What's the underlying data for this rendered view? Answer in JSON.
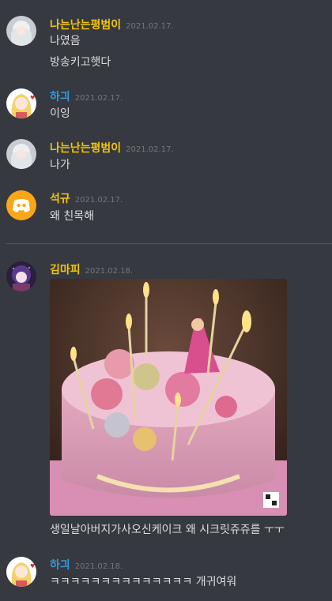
{
  "colors": {
    "background": "#36393f",
    "name_gold": "#f1c40f",
    "name_blue": "#3498db",
    "text": "#dcddde",
    "timestamp": "#72767d"
  },
  "messages": [
    {
      "author": "나는난는평범이",
      "color": "#f1c40f",
      "time": "2021.02.17.",
      "avatar": "white-hair-avatar",
      "lines": [
        "나였음",
        "방송키고햇다"
      ]
    },
    {
      "author": "하긔",
      "color": "#3498db",
      "time": "2021.02.17.",
      "avatar": "blonde-anime-avatar",
      "lines": [
        "이잉"
      ]
    },
    {
      "author": "나는난는평범이",
      "color": "#f1c40f",
      "time": "2021.02.17.",
      "avatar": "white-hair-avatar",
      "lines": [
        "나가"
      ]
    },
    {
      "author": "석규",
      "color": "#f1c40f",
      "time": "2021.02.17.",
      "avatar": "discord-default-avatar",
      "lines": [
        "왜 친목해"
      ]
    },
    {
      "author": "김마피",
      "color": "#f1c40f",
      "time": "2021.02.18.",
      "avatar": "purple-anime-avatar",
      "attachment": "birthday-cake-photo",
      "lines": [
        "생일날아버지가사오신케이크 왜 시크릿쥬쥬를 ㅜㅜ"
      ]
    },
    {
      "author": "하긔",
      "color": "#3498db",
      "time": "2021.02.18.",
      "avatar": "blonde-anime-avatar",
      "lines": [
        "ㅋㅋㅋㅋㅋㅋㅋㅋㅋㅋㅋㅋㅋㅋ 개귀여워"
      ]
    }
  ]
}
